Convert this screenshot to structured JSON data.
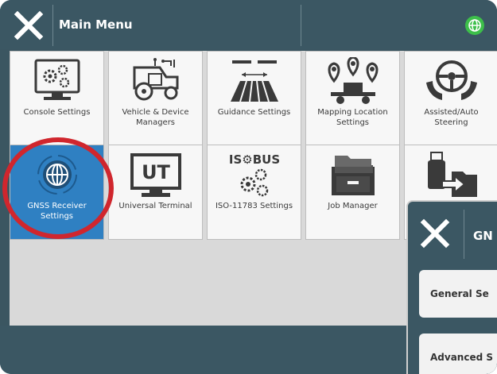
{
  "header": {
    "title": "Main Menu"
  },
  "tiles": [
    {
      "label": "Console Settings",
      "icon": "console-settings-icon"
    },
    {
      "label": "Vehicle & Device Managers",
      "icon": "vehicle-device-icon"
    },
    {
      "label": "Guidance Settings",
      "icon": "guidance-settings-icon"
    },
    {
      "label": "Mapping Location Settings",
      "icon": "mapping-location-icon"
    },
    {
      "label": "Assisted/Auto Steering",
      "icon": "steering-wheel-icon"
    },
    {
      "label": "GNSS Receiver Settings",
      "icon": "gnss-globe-icon",
      "selected": true
    },
    {
      "label": "Universal Terminal",
      "icon": "ut-monitor-icon",
      "icon_text": "UT"
    },
    {
      "label": "ISO-11783 Settings",
      "icon": "isobus-icon",
      "icon_text": "IS⚙BUS"
    },
    {
      "label": "Job Manager",
      "icon": "file-drawer-icon"
    },
    {
      "label": "",
      "icon": "usb-transfer-icon"
    }
  ],
  "popup": {
    "title": "GN",
    "items": [
      "General Se",
      "Advanced S"
    ]
  },
  "colors": {
    "bar": "#3b5763",
    "tile": "#f7f7f7",
    "selected": "#2f80c2",
    "highlight": "#d0262d",
    "gnss_icon": "#3dbf4a"
  }
}
